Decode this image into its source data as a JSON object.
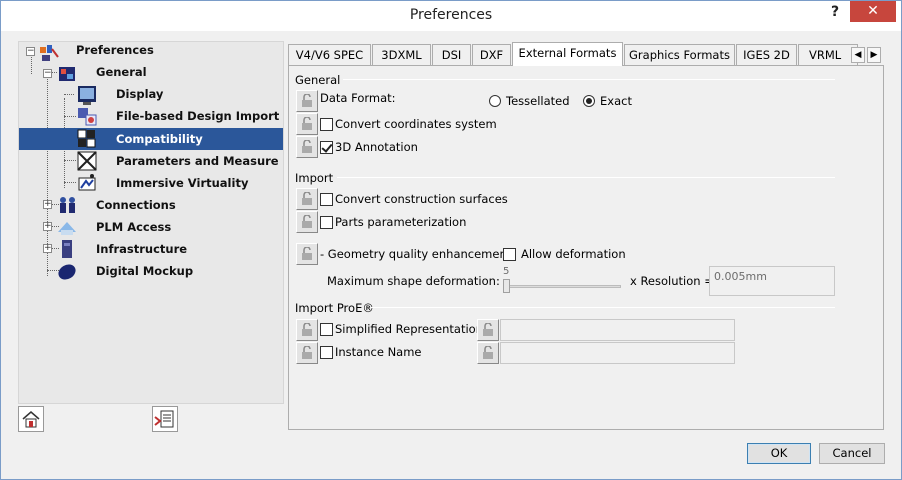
{
  "window": {
    "title": "Preferences",
    "help_label": "?",
    "close_label": "✕"
  },
  "tree": {
    "items": [
      {
        "label": "Preferences",
        "icon": "preferences-icon"
      },
      {
        "label": "General",
        "icon": "general-icon"
      },
      {
        "label": "Display",
        "icon": "display-icon"
      },
      {
        "label": "File-based Design Import",
        "icon": "file-import-icon"
      },
      {
        "label": "Compatibility",
        "icon": "compatibility-icon",
        "selected": true
      },
      {
        "label": "Parameters and Measure",
        "icon": "parameters-icon"
      },
      {
        "label": "Immersive Virtuality",
        "icon": "immersive-icon"
      },
      {
        "label": "Connections",
        "icon": "connections-icon"
      },
      {
        "label": "PLM Access",
        "icon": "plm-access-icon"
      },
      {
        "label": "Infrastructure",
        "icon": "infrastructure-icon"
      },
      {
        "label": "Digital Mockup",
        "icon": "digital-mockup-icon"
      }
    ]
  },
  "tabs": [
    {
      "label": "V4/V6 SPEC"
    },
    {
      "label": "3DXML"
    },
    {
      "label": "DSI"
    },
    {
      "label": "DXF"
    },
    {
      "label": "External Formats",
      "active": true
    },
    {
      "label": "Graphics Formats"
    },
    {
      "label": "IGES 2D"
    },
    {
      "label": "VRML"
    }
  ],
  "tab_scroll": {
    "left": "◀",
    "right": "▶"
  },
  "general": {
    "section_title": "General",
    "data_format_label": "Data Format:",
    "option_tessellated": "Tessellated",
    "option_exact": "Exact",
    "selected": "Exact",
    "convert_coordinates_label": "Convert coordinates system",
    "convert_coordinates_checked": false,
    "annotation_label": "3D Annotation",
    "annotation_checked": true
  },
  "import": {
    "section_title": "Import",
    "construction_surfaces_label": "Convert construction surfaces",
    "construction_surfaces_checked": false,
    "parts_param_label": "Parts parameterization",
    "parts_param_checked": false,
    "geometry_quality_label": "- Geometry quality enhancement:",
    "allow_deformation_label": "Allow deformation",
    "allow_deformation_checked": false,
    "max_shape_label": "Maximum shape deformation:",
    "slider_value": "5",
    "resolution_label": "x Resolution =",
    "resolution_value": "0.005mm"
  },
  "import_proe": {
    "section_title": "Import ProE®",
    "simplified_label": "Simplified Representation",
    "simplified_checked": false,
    "instance_label": "Instance Name",
    "instance_checked": false
  },
  "buttons": {
    "ok": "OK",
    "cancel": "Cancel"
  },
  "colors": {
    "selection": "#2b579a",
    "close_button": "#c7463d"
  }
}
